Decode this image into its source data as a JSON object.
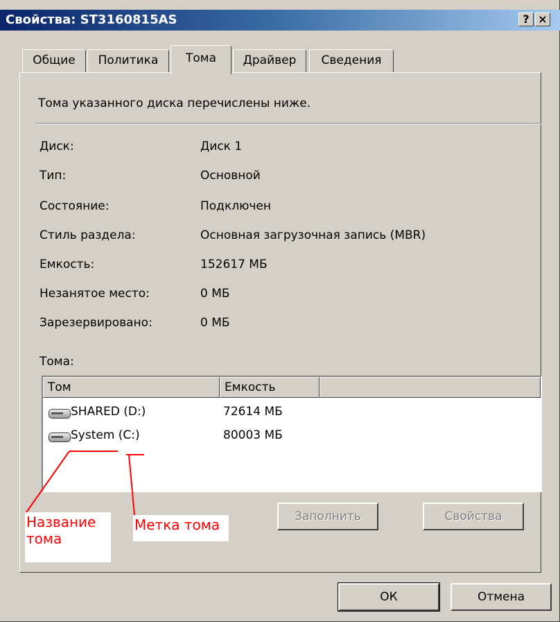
{
  "window": {
    "title": "Свойства: ST3160815AS",
    "help_button": "?",
    "close_button": "×"
  },
  "tabs": [
    "Общие",
    "Политика",
    "Тома",
    "Драйвер",
    "Сведения"
  ],
  "active_tab": "Тома",
  "panel": {
    "description": "Тома указанного диска перечислены ниже.",
    "fields": [
      {
        "label": "Диск:",
        "value": "Диск 1"
      },
      {
        "label": "Тип:",
        "value": "Основной"
      },
      {
        "label": "Состояние:",
        "value": "Подключен"
      },
      {
        "label": "Стиль раздела:",
        "value": "Основная загрузочная запись (MBR)"
      },
      {
        "label": "Емкость:",
        "value": "152617 МБ"
      },
      {
        "label": "Незанятое место:",
        "value": "0 МБ"
      },
      {
        "label": "Зарезервировано:",
        "value": "0 МБ"
      }
    ],
    "volumes_label": "Тома:",
    "volumes_table": {
      "columns": [
        "Том",
        "Емкость"
      ],
      "rows": [
        {
          "volume": "SHARED (D:)",
          "capacity": "72614 МБ",
          "icon": "drive-icon"
        },
        {
          "volume": "System (C:)",
          "capacity": "80003 МБ",
          "icon": "drive-icon"
        }
      ]
    },
    "populate_button": "Заполнить",
    "properties_button": "Свойства"
  },
  "footer": {
    "ok_button": "ОК",
    "cancel_button": "Отмена"
  },
  "annotations": {
    "volume_name": "Название тома",
    "volume_label": "Метка тома",
    "color": "#ff0000"
  }
}
